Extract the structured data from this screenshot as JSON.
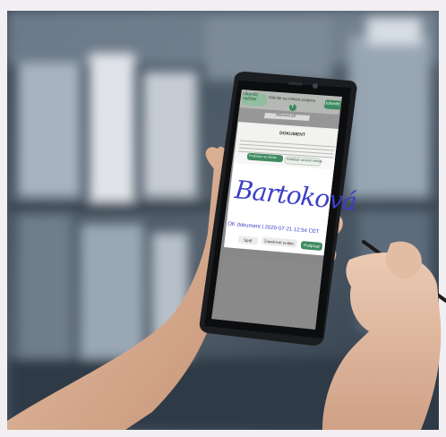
{
  "phone": {
    "back_button": "Ukončiť\nnačítať",
    "header_title": "Kliknite na miesto podpisu",
    "help_icon": "?",
    "done_button": "Dokončiť",
    "doc_tab": "Dokument.pdf",
    "doc_heading": "DOKUMENT",
    "tab_place": "Podpísať na mieste",
    "tab_other": "Podpísať na inom mieste",
    "signature_text": "Bartoková",
    "signature_meta": "OK dokument | 2020-07-21 12:54 CET",
    "btn_clear": "Späť",
    "btn_cancel": "Zopakovať podpis",
    "btn_confirm": "Podpísať"
  },
  "colors": {
    "accent": "#3f8a5f",
    "signature_ink": "#3b3fc4"
  }
}
